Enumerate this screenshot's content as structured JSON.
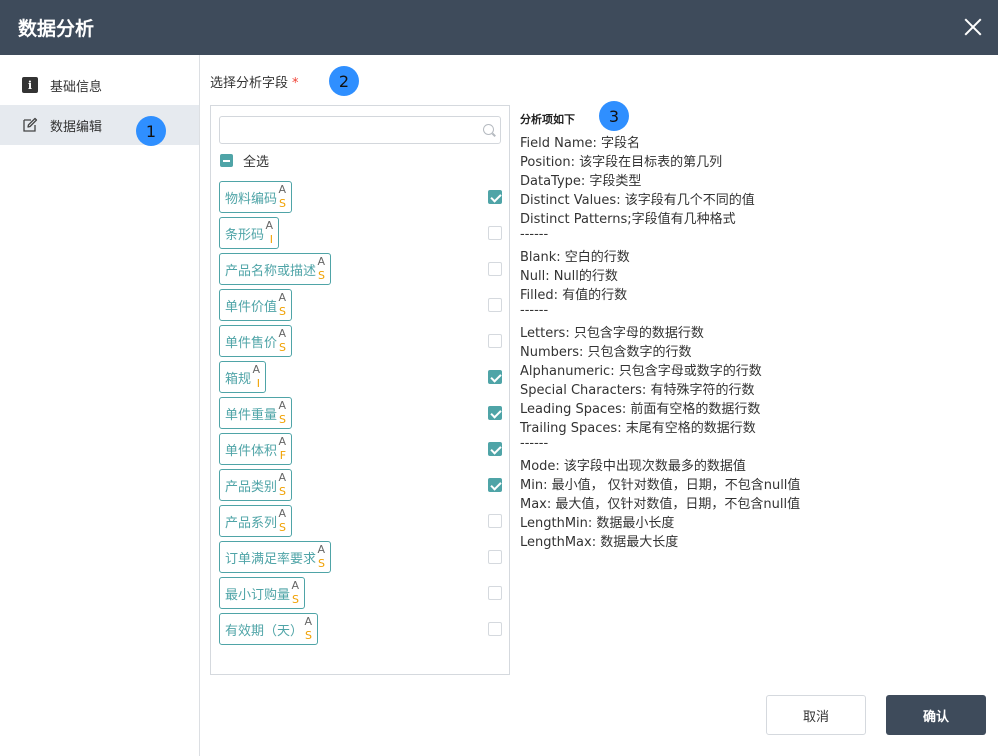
{
  "dialog": {
    "title": "数据分析",
    "close_icon": "close-icon"
  },
  "sidebar": {
    "items": [
      {
        "label": "基础信息",
        "icon": "info-icon",
        "active": false
      },
      {
        "label": "数据编辑",
        "icon": "edit-icon",
        "active": true
      }
    ]
  },
  "badges": [
    "1",
    "2",
    "3"
  ],
  "field_select": {
    "label": "选择分析字段",
    "required_mark": "*",
    "search_placeholder": "",
    "select_all_label": "全选",
    "fields": [
      {
        "name": "物料编码",
        "type_top": "A",
        "type_bottom": "S",
        "checked": true
      },
      {
        "name": "条形码",
        "type_top": "A",
        "type_bottom": "I",
        "checked": false
      },
      {
        "name": "产品名称或描述",
        "type_top": "A",
        "type_bottom": "S",
        "checked": false
      },
      {
        "name": "单件价值",
        "type_top": "A",
        "type_bottom": "S",
        "checked": false
      },
      {
        "name": "单件售价",
        "type_top": "A",
        "type_bottom": "S",
        "checked": false
      },
      {
        "name": "箱规",
        "type_top": "A",
        "type_bottom": "I",
        "checked": true
      },
      {
        "name": "单件重量",
        "type_top": "A",
        "type_bottom": "S",
        "checked": true
      },
      {
        "name": "单件体积",
        "type_top": "A",
        "type_bottom": "F",
        "checked": true
      },
      {
        "name": "产品类别",
        "type_top": "A",
        "type_bottom": "S",
        "checked": true
      },
      {
        "name": "产品系列",
        "type_top": "A",
        "type_bottom": "S",
        "checked": false
      },
      {
        "name": "订单满足率要求",
        "type_top": "A",
        "type_bottom": "S",
        "checked": false
      },
      {
        "name": "最小订购量",
        "type_top": "A",
        "type_bottom": "S",
        "checked": false
      },
      {
        "name": "有效期（天）",
        "type_top": "A",
        "type_bottom": "S",
        "checked": false
      }
    ]
  },
  "description": {
    "title": "分析项如下",
    "lines": [
      "Field Name: 字段名",
      "Position: 该字段在目标表的第几列",
      "DataType: 字段类型",
      "Distinct Values: 该字段有几个不同的值",
      "Distinct Patterns;字段值有几种格式",
      "------",
      "Blank: 空白的行数",
      "Null: Null的行数",
      "Filled: 有值的行数",
      "------",
      "Letters: 只包含字母的数据行数",
      "Numbers: 只包含数字的行数",
      "Alphanumeric: 只包含字母或数字的行数",
      "Special Characters: 有特殊字符的行数",
      "Leading Spaces: 前面有空格的数据行数",
      "Trailing Spaces: 末尾有空格的数据行数",
      "------",
      "Mode: 该字段中出现次数最多的数据值",
      "Min: 最小值，  仅针对数值，日期，不包含null值",
      "Max: 最大值，仅针对数值，日期，不包含null值",
      "LengthMin: 数据最小长度",
      "LengthMax: 数据最大长度"
    ]
  },
  "footer": {
    "cancel_label": "取消",
    "confirm_label": "确认"
  },
  "colors": {
    "header": "#3e4b5b",
    "accent": "#4fa4a7",
    "badge": "#2f8fff",
    "type_marker": "#f0a000",
    "required": "#f04134"
  }
}
